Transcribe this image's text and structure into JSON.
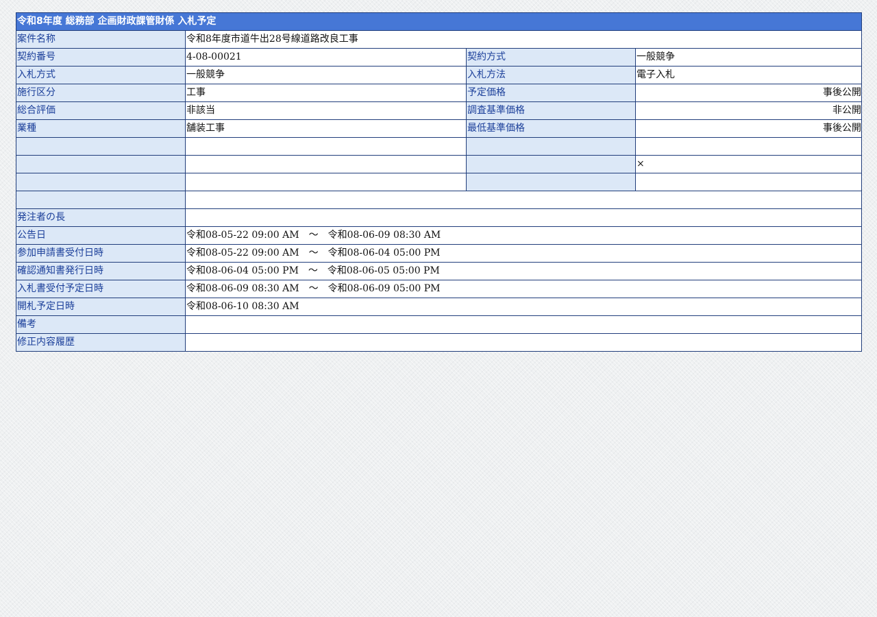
{
  "header": {
    "title": "令和8年度 総務部 企画財政課管財係 入札予定"
  },
  "rows": {
    "case_name_label": "案件名称",
    "case_name_value": "令和8年度市道牛出28号線道路改良工事",
    "contract_no_label": "契約番号",
    "contract_no_value": "4-08-00021",
    "contract_method_label": "契約方式",
    "contract_method_value": "一般競争",
    "bid_type_label": "入札方式",
    "bid_type_value": "一般競争",
    "bid_method_label": "入札方法",
    "bid_method_value": "電子入札",
    "exec_class_label": "施行区分",
    "exec_class_value": "工事",
    "planned_price_label": "予定価格",
    "planned_price_value": "事後公開",
    "overall_eval_label": "総合評価",
    "overall_eval_value": "非該当",
    "survey_price_label": "調査基準価格",
    "survey_price_value": "非公開",
    "industry_label": "業種",
    "industry_value": "舗装工事",
    "min_price_label": "最低基準価格",
    "min_price_value": "事後公開",
    "blank2_right_value": "×",
    "orderer_label": "発注者の長",
    "orderer_value": "",
    "notice_date_label": "公告日",
    "notice_date_value": "令和08-05-22 09:00 AM　～　令和08-06-09 08:30 AM",
    "application_label": "参加申請書受付日時",
    "application_value": "令和08-05-22 09:00 AM　～　令和08-06-04 05:00 PM",
    "confirmation_label": "確認通知書発行日時",
    "confirmation_value": "令和08-06-04 05:00 PM　～　令和08-06-05 05:00 PM",
    "bid_acceptance_label": "入札書受付予定日時",
    "bid_acceptance_value": "令和08-06-09 08:30 AM　～　令和08-06-09 05:00 PM",
    "opening_label": "開札予定日時",
    "opening_value": "令和08-06-10 08:30 AM",
    "remarks_label": "備考",
    "remarks_value": "",
    "revision_label": "修正内容履歴",
    "revision_value": ""
  }
}
